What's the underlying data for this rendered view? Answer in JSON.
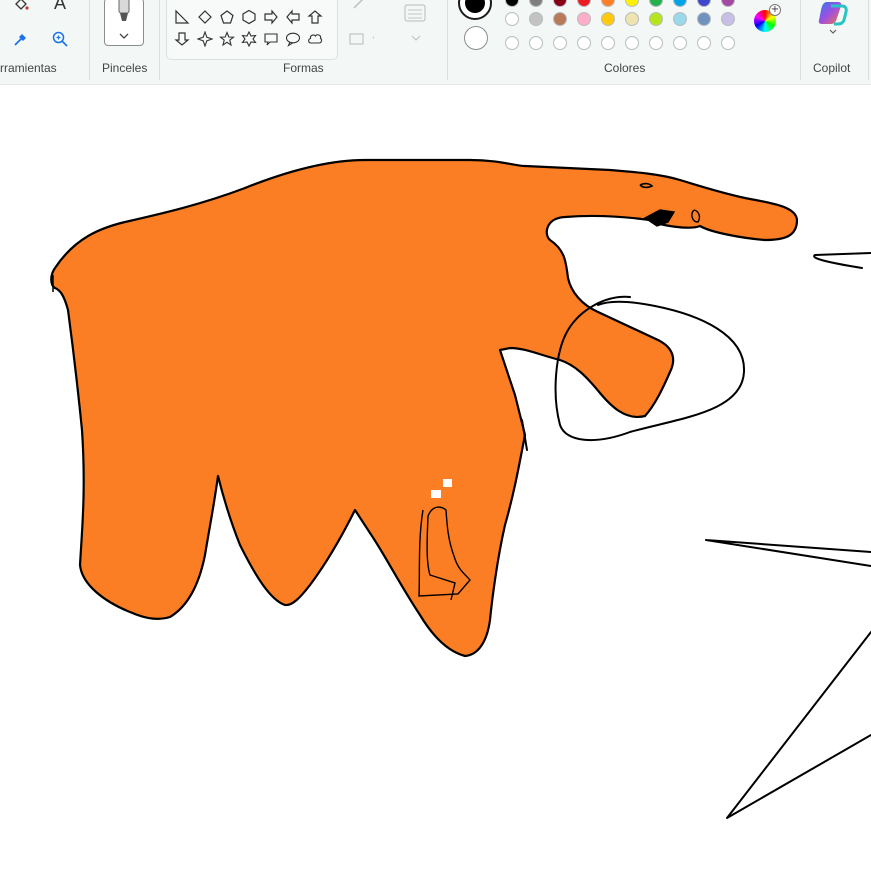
{
  "ribbon": {
    "groups": {
      "tools": "rramientas",
      "brushes": "Pinceles",
      "shapes": "Formas",
      "colors": "Colores",
      "copilot": "Copilot"
    },
    "text_tool_glyph": "A"
  },
  "colors": {
    "accent": "#fb7e24",
    "fill_shape": "#fb7e24",
    "outline": "#000000",
    "palette_row1": [
      "#000000",
      "#7f7f7f",
      "#880015",
      "#ed1c24",
      "#ff7f27",
      "#fff200",
      "#22b14c",
      "#00a2e8",
      "#3f48cc",
      "#a349a4"
    ],
    "palette_row2": [
      "#ffffff",
      "#c3c3c3",
      "#b97a57",
      "#ffaec9",
      "#ffc90e",
      "#efe4b0",
      "#b5e61d",
      "#99d9ea",
      "#7092be",
      "#c8bfe7"
    ],
    "palette_row3_count": 10
  },
  "icons": {
    "fill": "fill-bucket-icon",
    "text": "text-icon",
    "picker": "color-picker-icon",
    "zoom": "magnifier-icon",
    "brush": "brush-icon",
    "copilot": "copilot-icon",
    "edit_colors": "color-wheel-icon"
  }
}
